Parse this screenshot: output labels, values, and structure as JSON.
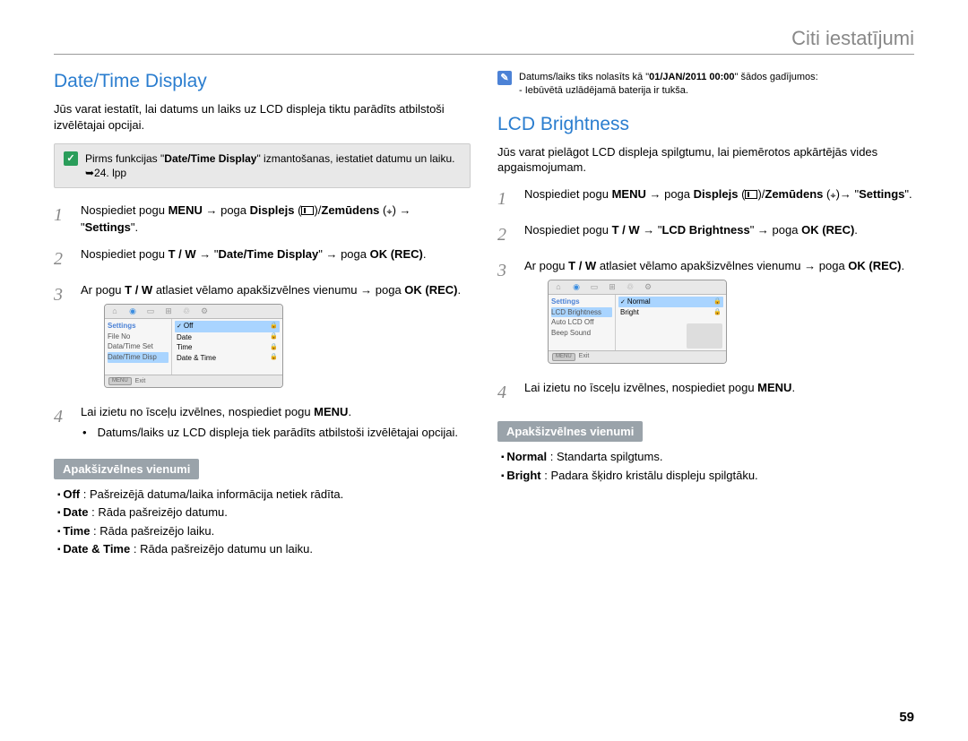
{
  "header": "Citi iestatījumi",
  "page_num": "59",
  "left": {
    "title": "Date/Time Display",
    "intro": "Jūs varat iestatīt, lai datums un laiks uz LCD displeja tiktu parādīts atbilstoši izvēlētajai opcijai.",
    "note_before": "Pirms funkcijas \"",
    "note_bold": "Date/Time Display",
    "note_after": "\" izmantošanas, iestatiet datumu un laiku. ➥24. lpp",
    "step1_a": "Nospiediet pogu ",
    "step1_menu": "MENU",
    "step1_b": " → poga ",
    "step1_disp": "Displejs",
    "step1_c": " (",
    "step1_d": ")/",
    "step1_zem": "Zemūdens",
    "step1_e": " (",
    "step1_f": ") → \"",
    "step1_set": "Settings",
    "step1_g": "\".",
    "step2_a": "Nospiediet pogu ",
    "step2_tw": "T / W",
    "step2_b": " → \"",
    "step2_dt": "Date/Time Display",
    "step2_c": "\" → poga ",
    "step2_ok": "OK (REC)",
    "step2_d": ".",
    "step3_a": "Ar pogu ",
    "step3_tw": "T / W",
    "step3_b": " atlasiet vēlamo apakšizvēlnes vienumu → poga ",
    "step3_ok": "OK (REC)",
    "step3_c": ".",
    "step4_a": "Lai izietu no īsceļu izvēlnes, nospiediet pogu ",
    "step4_menu": "MENU",
    "step4_b": ".",
    "step4_sub": "Datums/laiks uz LCD displeja tiek parādīts atbilstoši izvēlētajai opcijai.",
    "subhead": "Apakšizvēlnes vienumi",
    "items": {
      "off_l": "Off",
      "off_t": " : Pašreizējā datuma/laika informācija netiek rādīta.",
      "date_l": "Date",
      "date_t": " : Rāda pašreizējo datumu.",
      "time_l": "Time",
      "time_t": " : Rāda pašreizējo laiku.",
      "dt_l": "Date & Time",
      "dt_t": " : Rāda pašreizējo datumu un laiku."
    },
    "lcd": {
      "hdr": "Settings",
      "side1": "File No",
      "side2": "Data/Time Set",
      "side3": "Date/Time Disp",
      "opt1": "Off",
      "opt2": "Date",
      "opt3": "Time",
      "opt4": "Date & Time",
      "exit": "Exit"
    }
  },
  "right": {
    "top_note_a": "Datums/laiks tiks nolasīts kā \"",
    "top_note_b": "01/JAN/2011 00:00",
    "top_note_c": "\" šādos gadījumos:",
    "top_note_sub": "- Iebūvētā uzlādējamā baterija ir tukša.",
    "title": "LCD Brightness",
    "intro": "Jūs varat pielāgot LCD displeja spilgtumu, lai piemērotos apkārtējās vides apgaismojumam.",
    "step1_a": "Nospiediet pogu ",
    "step1_menu": "MENU",
    "step1_b": " → poga ",
    "step1_disp": "Displejs",
    "step1_c": " (",
    "step1_d": ")/",
    "step1_zem": "Zemūdens",
    "step1_e": " (",
    "step1_f": ")→ \"",
    "step1_set": "Settings",
    "step1_g": "\".",
    "step2_a": "Nospiediet pogu ",
    "step2_tw": "T / W",
    "step2_b": " → \"",
    "step2_lb": "LCD Brightness",
    "step2_c": "\" → poga ",
    "step2_ok": "OK (REC)",
    "step2_d": ".",
    "step3_a": "Ar pogu ",
    "step3_tw": "T / W",
    "step3_b": " atlasiet vēlamo apakšizvēlnes vienumu → poga ",
    "step3_ok": "OK (REC)",
    "step3_c": ".",
    "step4_a": "Lai izietu no īsceļu izvēlnes, nospiediet pogu ",
    "step4_menu": "MENU",
    "step4_b": ".",
    "subhead": "Apakšizvēlnes vienumi",
    "items": {
      "normal_l": "Normal",
      "normal_t": " : Standarta spilgtums.",
      "bright_l": "Bright",
      "bright_t": " : Padara šķidro kristālu displeju spilgtāku."
    },
    "lcd": {
      "hdr": "Settings",
      "side1": "LCD Brightness",
      "side2": "Auto LCD Off",
      "side3": "Beep Sound",
      "opt1": "Normal",
      "opt2": "Bright",
      "exit": "Exit"
    }
  }
}
